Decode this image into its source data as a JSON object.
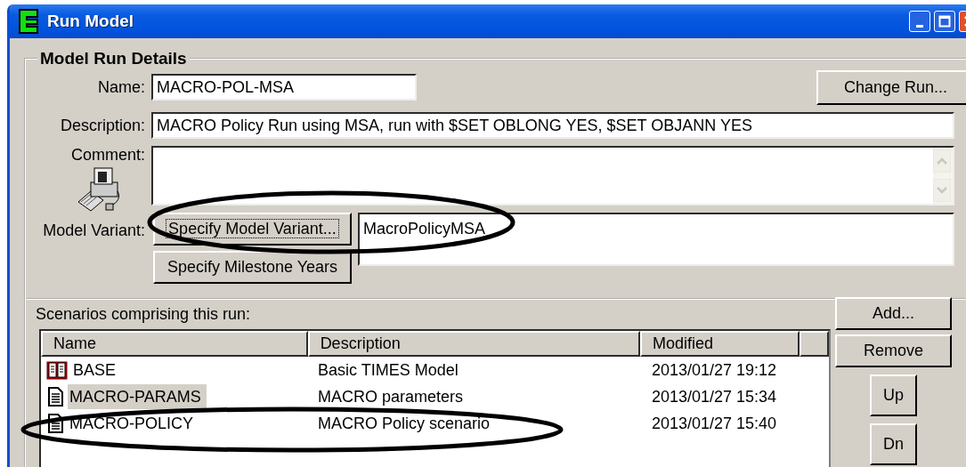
{
  "window": {
    "title": "Run Model"
  },
  "details": {
    "legend": "Model Run Details",
    "name_label": "Name:",
    "name": "MACRO-POL-MSA",
    "change_button": "Change Run...",
    "description_label": "Description:",
    "description": "MACRO Policy Run using MSA, run with $SET OBLONG YES, $SET OBJANN YES",
    "comment_label": "Comment:",
    "variant_label": "Model Variant:",
    "variant_button": {
      "label": "Specify Model Variant...",
      "focused": true
    },
    "variant": "MacroPolicyMSA",
    "milestone_button": {
      "label": "Specify Milestone Years",
      "focused": false
    }
  },
  "scenarios": {
    "label": "Scenarios comprising this run:",
    "columns": [
      "Name",
      "Description",
      "Modified"
    ],
    "rows": [
      {
        "kind": "book",
        "name": "BASE",
        "description": "Basic TIMES Model",
        "modified": "2013/01/27 19:12",
        "selected": false
      },
      {
        "kind": "document",
        "name": "MACRO-PARAMS",
        "description": "MACRO parameters",
        "modified": "2013/01/27 15:34",
        "selected": true
      },
      {
        "kind": "document",
        "name": "MACRO-POLICY",
        "description": "MACRO Policy scenario",
        "modified": "2013/01/27 15:40",
        "selected": false
      }
    ],
    "buttons": [
      "Add...",
      "Remove",
      "Up",
      "Dn"
    ]
  }
}
